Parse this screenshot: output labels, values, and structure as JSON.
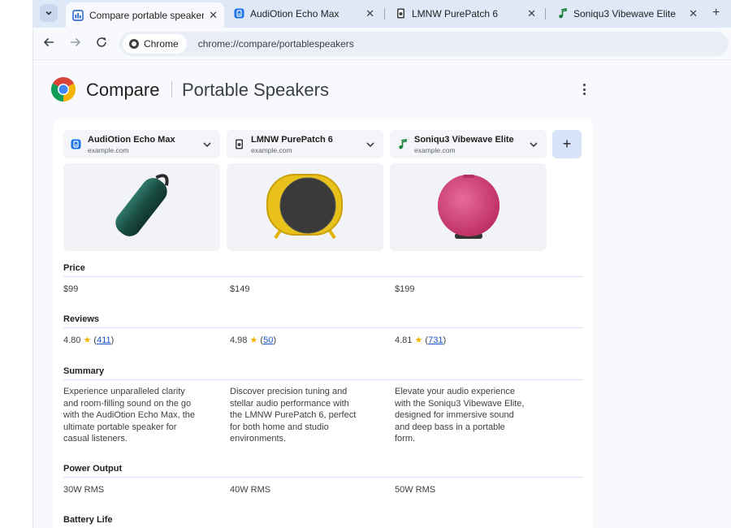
{
  "tabs": [
    {
      "title": "Compare portable speakers",
      "icon": "compare-icon",
      "active": true
    },
    {
      "title": "AudiOtion Echo Max",
      "icon": "audiotion-logo-icon",
      "active": false
    },
    {
      "title": "LMNW PurePatch 6",
      "icon": "lmnw-logo-icon",
      "active": false
    },
    {
      "title": "Soniqu3 Vibewave Elite",
      "icon": "music-note-icon",
      "active": false
    }
  ],
  "toolbar": {
    "chip_label": "Chrome",
    "url": "chrome://compare/portablespeakers"
  },
  "header": {
    "brand": "Compare",
    "title": "Portable Speakers"
  },
  "products": [
    {
      "name": "AudiOtion Echo Max",
      "site": "example.com",
      "icon": "audiotion-logo-icon",
      "image": "teal cylindrical speaker"
    },
    {
      "name": "LMNW PurePatch 6",
      "site": "example.com",
      "icon": "lmnw-logo-icon",
      "image": "yellow round speaker"
    },
    {
      "name": "Soniqu3 Vibewave Elite",
      "site": "example.com",
      "icon": "music-note-icon",
      "image": "pink round speaker"
    }
  ],
  "sections": {
    "price": {
      "label": "Price",
      "values": [
        "$99",
        "$149",
        "$199"
      ]
    },
    "reviews": {
      "label": "Reviews",
      "values": [
        {
          "rating": "4.80",
          "count": "411"
        },
        {
          "rating": "4.98",
          "count": "50"
        },
        {
          "rating": "4.81",
          "count": "731"
        }
      ]
    },
    "summary": {
      "label": "Summary",
      "values": [
        [
          "Experience unparalleled clarity",
          "and room-filling sound on the go",
          "with the AudiOtion Echo Max, the",
          "ultimate portable speaker for",
          "casual listeners."
        ],
        [
          "Discover precision tuning and",
          "stellar audio performance with",
          "the LMNW PurePatch 6, perfect",
          "for both home and studio",
          "environments."
        ],
        [
          "Elevate your audio experience",
          "with the Soniqu3 Vibewave Elite,",
          "designed for immersive sound",
          "and deep bass in a portable",
          "form."
        ]
      ]
    },
    "power": {
      "label": "Power Output",
      "values": [
        "30W RMS",
        "40W RMS",
        "50W RMS"
      ]
    },
    "battery": {
      "label": "Battery Life"
    }
  },
  "colors": {
    "accent": "#1a55c6",
    "tabstrip": "#dfe8f6",
    "star": "#f6b400",
    "add_button": "#d7e3f8"
  }
}
